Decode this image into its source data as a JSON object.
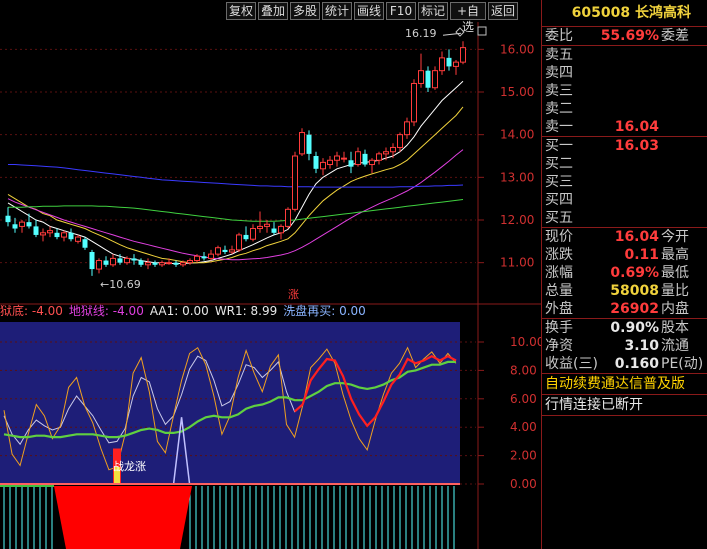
{
  "toolbar": {
    "buttons": [
      "复权",
      "叠加",
      "多股",
      "统计",
      "画线",
      "F10",
      "标记",
      "+自选",
      "返回"
    ]
  },
  "stock": {
    "code": "605008",
    "name": "长鸿高科"
  },
  "order_book": {
    "wei_bi_label": "委比",
    "wei_bi_value": "55.69%",
    "wei_cha_label": "委差",
    "sell": [
      {
        "label": "卖五",
        "price": ""
      },
      {
        "label": "卖四",
        "price": ""
      },
      {
        "label": "卖三",
        "price": ""
      },
      {
        "label": "卖二",
        "price": ""
      },
      {
        "label": "卖一",
        "price": "16.04"
      }
    ],
    "buy": [
      {
        "label": "买一",
        "price": "16.03"
      },
      {
        "label": "买二",
        "price": ""
      },
      {
        "label": "买三",
        "price": ""
      },
      {
        "label": "买四",
        "price": ""
      },
      {
        "label": "买五",
        "price": ""
      }
    ]
  },
  "quote": [
    {
      "label": "现价",
      "value": "16.04",
      "tail": "今开"
    },
    {
      "label": "涨跌",
      "value": "0.11",
      "tail": "最高"
    },
    {
      "label": "涨幅",
      "value": "0.69%",
      "tail": "最低"
    },
    {
      "label": "总量",
      "value": "58008",
      "tail": "量比"
    },
    {
      "label": "外盘",
      "value": "26902",
      "tail": "内盘"
    }
  ],
  "stats": [
    {
      "label": "换手",
      "value": "0.90%",
      "tail": "股本"
    },
    {
      "label": "净资",
      "value": "3.10",
      "tail": "流通"
    },
    {
      "label": "收益(三)",
      "value": "0.160",
      "tail": "PE(动)"
    }
  ],
  "footer": {
    "link": "自动续费通达信普及版",
    "status": "行情连接已断开"
  },
  "chart_data": {
    "type": "candlestick",
    "price_axis": {
      "ticks": [
        11.0,
        12.0,
        13.0,
        14.0,
        15.0,
        16.0
      ],
      "range": [
        10.5,
        16.5
      ]
    },
    "annotations": {
      "high": "16.19",
      "low": "10.69",
      "zhang_marker": "涨",
      "special_label": "战龙涨"
    },
    "candles": [
      [
        12.1,
        12.3,
        11.85,
        11.95
      ],
      [
        11.9,
        12.05,
        11.7,
        11.8
      ],
      [
        11.85,
        12.0,
        11.7,
        11.95
      ],
      [
        11.95,
        12.15,
        11.8,
        11.85
      ],
      [
        11.85,
        12.0,
        11.6,
        11.65
      ],
      [
        11.65,
        11.8,
        11.5,
        11.7
      ],
      [
        11.7,
        11.85,
        11.6,
        11.75
      ],
      [
        11.7,
        11.8,
        11.55,
        11.6
      ],
      [
        11.6,
        11.75,
        11.5,
        11.7
      ],
      [
        11.7,
        11.8,
        11.5,
        11.55
      ],
      [
        11.5,
        11.65,
        11.45,
        11.6
      ],
      [
        11.55,
        11.6,
        11.3,
        11.35
      ],
      [
        11.25,
        11.3,
        10.69,
        10.85
      ],
      [
        10.85,
        11.1,
        10.75,
        11.05
      ],
      [
        11.05,
        11.15,
        10.9,
        10.95
      ],
      [
        10.95,
        11.2,
        10.9,
        11.1
      ],
      [
        11.1,
        11.2,
        10.95,
        11.0
      ],
      [
        11.0,
        11.15,
        10.95,
        11.1
      ],
      [
        11.1,
        11.2,
        10.95,
        11.05
      ],
      [
        11.05,
        11.1,
        10.9,
        10.95
      ],
      [
        10.95,
        11.1,
        10.85,
        11.0
      ],
      [
        11.0,
        11.05,
        10.9,
        10.95
      ],
      [
        10.95,
        11.05,
        10.9,
        11.0
      ],
      [
        11.0,
        11.1,
        10.95,
        11.0
      ],
      [
        11.0,
        11.05,
        10.9,
        10.95
      ],
      [
        10.95,
        11.05,
        10.9,
        11.0
      ],
      [
        11.0,
        11.1,
        10.95,
        11.05
      ],
      [
        11.05,
        11.2,
        11.0,
        11.15
      ],
      [
        11.15,
        11.25,
        11.05,
        11.1
      ],
      [
        11.1,
        11.3,
        11.05,
        11.2
      ],
      [
        11.2,
        11.4,
        11.15,
        11.35
      ],
      [
        11.3,
        11.4,
        11.2,
        11.25
      ],
      [
        11.25,
        11.4,
        11.2,
        11.3
      ],
      [
        11.3,
        11.7,
        11.25,
        11.65
      ],
      [
        11.65,
        11.85,
        11.5,
        11.55
      ],
      [
        11.55,
        11.9,
        11.5,
        11.8
      ],
      [
        11.8,
        12.2,
        11.7,
        11.85
      ],
      [
        11.85,
        12.0,
        11.7,
        11.9
      ],
      [
        11.8,
        11.95,
        11.65,
        11.7
      ],
      [
        11.7,
        11.9,
        11.55,
        11.85
      ],
      [
        11.85,
        12.3,
        11.8,
        12.25
      ],
      [
        12.25,
        13.6,
        12.2,
        13.5
      ],
      [
        13.55,
        14.15,
        13.5,
        14.05
      ],
      [
        14.0,
        14.1,
        13.4,
        13.55
      ],
      [
        13.5,
        13.6,
        13.1,
        13.2
      ],
      [
        13.2,
        13.45,
        13.05,
        13.35
      ],
      [
        13.3,
        13.5,
        13.2,
        13.4
      ],
      [
        13.4,
        13.6,
        13.25,
        13.5
      ],
      [
        13.45,
        13.6,
        13.35,
        13.45
      ],
      [
        13.4,
        13.6,
        13.1,
        13.25
      ],
      [
        13.3,
        13.7,
        13.25,
        13.6
      ],
      [
        13.55,
        13.65,
        13.25,
        13.3
      ],
      [
        13.3,
        13.45,
        13.1,
        13.4
      ],
      [
        13.4,
        13.6,
        13.3,
        13.55
      ],
      [
        13.55,
        13.7,
        13.4,
        13.6
      ],
      [
        13.6,
        13.8,
        13.45,
        13.7
      ],
      [
        13.7,
        14.05,
        13.6,
        14.0
      ],
      [
        14.0,
        14.4,
        13.9,
        14.3
      ],
      [
        14.3,
        15.3,
        14.2,
        15.2
      ],
      [
        15.2,
        15.9,
        15.1,
        15.5
      ],
      [
        15.5,
        15.6,
        15.0,
        15.1
      ],
      [
        15.1,
        15.6,
        15.05,
        15.5
      ],
      [
        15.5,
        15.95,
        15.4,
        15.8
      ],
      [
        15.8,
        16.0,
        15.5,
        15.6
      ],
      [
        15.6,
        15.75,
        15.4,
        15.7
      ],
      [
        15.7,
        16.19,
        15.65,
        16.04
      ]
    ],
    "ma_lines": [
      {
        "color": "#ffffff",
        "values": [
          12.4,
          12.3,
          12.2,
          12.1,
          12.0,
          11.95,
          11.85,
          11.8,
          11.75,
          11.7,
          11.65,
          11.6,
          11.5,
          11.4,
          11.3,
          11.2,
          11.15,
          11.1,
          11.08,
          11.05,
          11.02,
          11.0,
          11.0,
          10.98,
          10.98,
          10.98,
          10.99,
          11.0,
          11.02,
          11.05,
          11.1,
          11.15,
          11.2,
          11.28,
          11.35,
          11.42,
          11.5,
          11.58,
          11.65,
          11.7,
          11.78,
          12.0,
          12.3,
          12.6,
          12.85,
          13.0,
          13.1,
          13.2,
          13.25,
          13.3,
          13.33,
          13.35,
          13.37,
          13.4,
          13.45,
          13.5,
          13.6,
          13.75,
          13.95,
          14.2,
          14.4,
          14.6,
          14.8,
          14.95,
          15.1,
          15.25
        ]
      },
      {
        "color": "#f0d23c",
        "values": [
          12.6,
          12.5,
          12.4,
          12.3,
          12.25,
          12.15,
          12.1,
          12.0,
          11.95,
          11.9,
          11.85,
          11.8,
          11.72,
          11.65,
          11.58,
          11.5,
          11.42,
          11.35,
          11.3,
          11.25,
          11.2,
          11.15,
          11.1,
          11.08,
          11.05,
          11.02,
          11.0,
          11.0,
          11.0,
          11.02,
          11.05,
          11.08,
          11.12,
          11.18,
          11.22,
          11.28,
          11.33,
          11.4,
          11.45,
          11.5,
          11.56,
          11.7,
          11.9,
          12.1,
          12.28,
          12.45,
          12.58,
          12.7,
          12.8,
          12.9,
          12.97,
          13.03,
          13.08,
          13.13,
          13.18,
          13.22,
          13.3,
          13.4,
          13.55,
          13.7,
          13.85,
          14.0,
          14.15,
          14.3,
          14.45,
          14.65
        ]
      },
      {
        "color": "#e040e0",
        "values": [
          12.5,
          12.42,
          12.36,
          12.3,
          12.24,
          12.18,
          12.12,
          12.06,
          12.0,
          11.95,
          11.9,
          11.85,
          11.8,
          11.75,
          11.7,
          11.65,
          11.6,
          11.55,
          11.5,
          11.46,
          11.42,
          11.38,
          11.34,
          11.3,
          11.26,
          11.22,
          11.19,
          11.16,
          11.13,
          11.11,
          11.09,
          11.08,
          11.07,
          11.07,
          11.08,
          11.09,
          11.1,
          11.12,
          11.15,
          11.18,
          11.22,
          11.28,
          11.36,
          11.45,
          11.55,
          11.65,
          11.75,
          11.85,
          11.95,
          12.05,
          12.14,
          12.22,
          12.3,
          12.38,
          12.45,
          12.52,
          12.6,
          12.68,
          12.77,
          12.88,
          13.0,
          13.12,
          13.25,
          13.38,
          13.52,
          13.65
        ]
      },
      {
        "color": "#40d040",
        "values": [
          12.3,
          12.3,
          12.3,
          12.31,
          12.31,
          12.32,
          12.32,
          12.32,
          12.33,
          12.33,
          12.33,
          12.33,
          12.33,
          12.32,
          12.32,
          12.31,
          12.3,
          12.29,
          12.28,
          12.26,
          12.24,
          12.22,
          12.2,
          12.18,
          12.16,
          12.14,
          12.12,
          12.1,
          12.08,
          12.06,
          12.04,
          12.02,
          12.0,
          11.99,
          11.98,
          11.97,
          11.97,
          11.97,
          11.97,
          11.98,
          11.99,
          12.0,
          12.02,
          12.04,
          12.06,
          12.08,
          12.1,
          12.12,
          12.14,
          12.16,
          12.18,
          12.2,
          12.22,
          12.24,
          12.26,
          12.28,
          12.3,
          12.32,
          12.34,
          12.36,
          12.38,
          12.4,
          12.42,
          12.44,
          12.46,
          12.48
        ]
      },
      {
        "color": "#3a3aff",
        "values": [
          13.3,
          13.3,
          13.29,
          13.28,
          13.27,
          13.26,
          13.25,
          13.24,
          13.22,
          13.2,
          13.18,
          13.16,
          13.14,
          13.12,
          13.1,
          13.08,
          13.06,
          13.04,
          13.02,
          13.0,
          12.98,
          12.96,
          12.94,
          12.93,
          12.92,
          12.91,
          12.9,
          12.89,
          12.88,
          12.87,
          12.86,
          12.85,
          12.84,
          12.83,
          12.82,
          12.81,
          12.8,
          12.8,
          12.79,
          12.79,
          12.78,
          12.78,
          12.78,
          12.78,
          12.77,
          12.77,
          12.77,
          12.77,
          12.77,
          12.77,
          12.77,
          12.77,
          12.77,
          12.77,
          12.77,
          12.77,
          12.78,
          12.78,
          12.78,
          12.79,
          12.79,
          12.8,
          12.8,
          12.81,
          12.81,
          12.82
        ]
      }
    ],
    "indicator": {
      "header": [
        {
          "text": "狱底: -4.00",
          "color": "#ff5050"
        },
        {
          "text": "地狱线: -4.00",
          "color": "#e040e0"
        },
        {
          "text": "AA1: 0.00",
          "color": "#e8e8e8"
        },
        {
          "text": "WR1: 8.99",
          "color": "#e8e8e8"
        },
        {
          "text": "洗盘再买: 0.00",
          "color": "#8ab4ff"
        }
      ],
      "axis_ticks": [
        "10.00",
        "8.00",
        "6.00",
        "4.00",
        "2.00",
        "0.00"
      ],
      "range": [
        0,
        10
      ],
      "orange": [
        5.2,
        2.1,
        1.3,
        3.5,
        5.6,
        4.8,
        3.2,
        4.1,
        6.8,
        7.5,
        5.5,
        4.3,
        2.5,
        1.0,
        1.2,
        3.5,
        7.8,
        8.9,
        6.5,
        3.0,
        2.2,
        4.8,
        7.3,
        9.2,
        9.6,
        8.4,
        6.2,
        3.5,
        4.8,
        7.5,
        9.4,
        7.8,
        6.5,
        8.3,
        9.1,
        4.2,
        3.3,
        5.5,
        8.2,
        8.8,
        9.5,
        8.5,
        6.3,
        4.5,
        3.2,
        2.4,
        4.5,
        6.3,
        7.8,
        8.5,
        9.6,
        8.2,
        8.8,
        9.3,
        8.5,
        9.2,
        8.5
      ],
      "white": [
        4.8,
        3.5,
        2.8,
        3.8,
        4.5,
        4.1,
        3.8,
        4.0,
        5.3,
        6.2,
        5.5,
        4.8,
        3.8,
        2.9,
        3.0,
        3.9,
        6.2,
        7.5,
        7.2,
        5.3,
        4.2,
        4.8,
        6.3,
        8.1,
        9.0,
        8.7,
        7.3,
        5.5,
        5.8,
        7.0,
        8.4,
        8.2,
        7.5,
        8.0,
        8.6,
        6.5,
        5.1,
        5.6,
        7.3,
        8.1,
        8.8,
        8.7,
        7.6,
        6.0,
        4.9,
        4.1,
        4.7,
        5.8,
        7.0,
        7.7,
        8.8,
        8.5,
        8.7,
        9.0,
        8.7,
        9.0,
        8.7
      ],
      "green": [
        3.5,
        3.4,
        3.3,
        3.3,
        3.4,
        3.4,
        3.3,
        3.3,
        3.4,
        3.5,
        3.5,
        3.5,
        3.4,
        3.3,
        3.3,
        3.4,
        3.6,
        3.8,
        3.9,
        3.8,
        3.6,
        3.6,
        3.7,
        4.0,
        4.4,
        4.7,
        4.8,
        4.7,
        4.7,
        4.9,
        5.3,
        5.5,
        5.6,
        5.8,
        6.1,
        6.1,
        5.9,
        5.9,
        6.2,
        6.5,
        6.9,
        7.1,
        7.1,
        7.0,
        6.8,
        6.7,
        6.8,
        7.0,
        7.3,
        7.5,
        7.9,
        8.0,
        8.2,
        8.4,
        8.4,
        8.6,
        8.6
      ],
      "red_overlay_x_range": [
        36,
        56
      ],
      "spike_blue": {
        "x": 22,
        "height": 4.7
      },
      "spike_red": {
        "x": 14,
        "height": 2.5
      }
    }
  }
}
